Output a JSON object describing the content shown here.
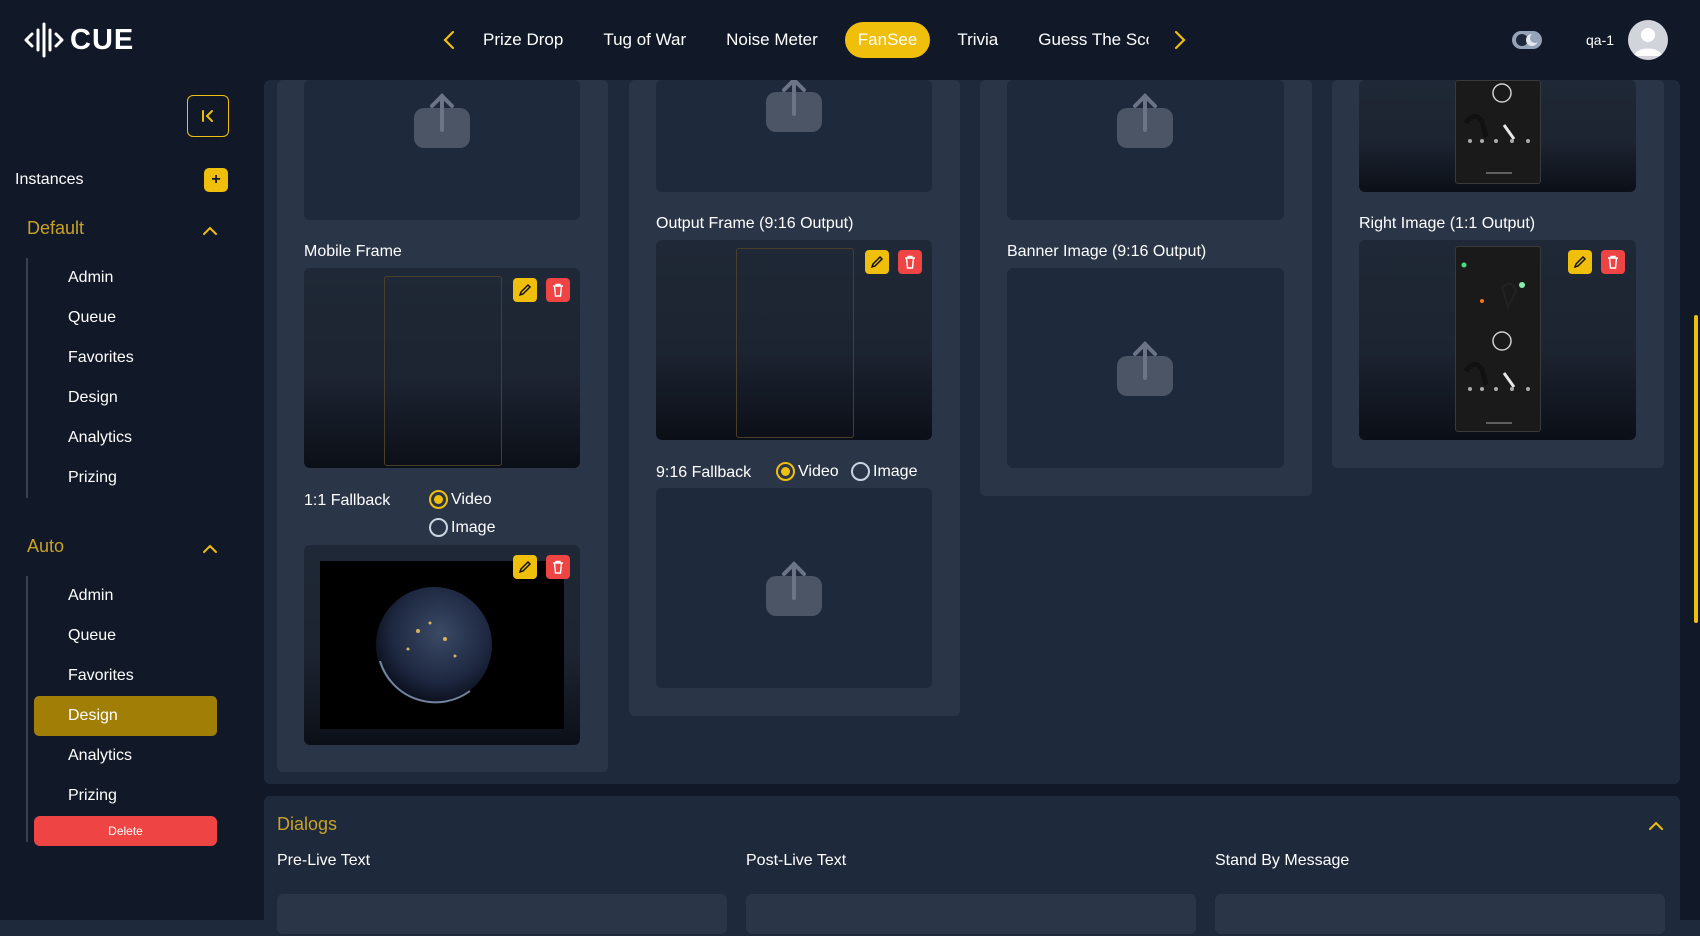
{
  "app": {
    "logo_text": "CUE",
    "user": "qa-1"
  },
  "nav": {
    "tabs": [
      {
        "label": "Prize Drop",
        "active": false
      },
      {
        "label": "Tug of War",
        "active": false
      },
      {
        "label": "Noise Meter",
        "active": false
      },
      {
        "label": "FanSee",
        "active": true
      },
      {
        "label": "Trivia",
        "active": false
      },
      {
        "label": "Guess The Score",
        "active": false
      }
    ]
  },
  "sidebar": {
    "instances_label": "Instances",
    "add_label": "+",
    "groups": [
      {
        "title": "Default",
        "items": [
          "Admin",
          "Queue",
          "Favorites",
          "Design",
          "Analytics",
          "Prizing"
        ]
      },
      {
        "title": "Auto",
        "items": [
          "Admin",
          "Queue",
          "Favorites",
          "Design",
          "Analytics",
          "Prizing"
        ],
        "active_item": "Design"
      }
    ],
    "delete_label": "Delete"
  },
  "design": {
    "col1": {
      "mobile_frame_label": "Mobile Frame",
      "fallback_label": "1:1 Fallback",
      "fallback_options": [
        "Video",
        "Image"
      ],
      "fallback_selected": "Video"
    },
    "col2": {
      "output_frame_label": "Output Frame (9:16 Output)",
      "fallback_label": "9:16 Fallback",
      "fallback_options": [
        "Video",
        "Image"
      ],
      "fallback_selected": "Video"
    },
    "col3": {
      "banner_label": "Banner Image (9:16 Output)"
    },
    "col4": {
      "right_image_label": "Right Image (1:1 Output)"
    }
  },
  "dialogs": {
    "title": "Dialogs",
    "fields": [
      "Pre-Live Text",
      "Post-Live Text",
      "Stand By Message"
    ]
  },
  "colors": {
    "accent": "#f0bf0b",
    "danger": "#ef4444",
    "background": "#111827",
    "panel": "#2a3648"
  }
}
